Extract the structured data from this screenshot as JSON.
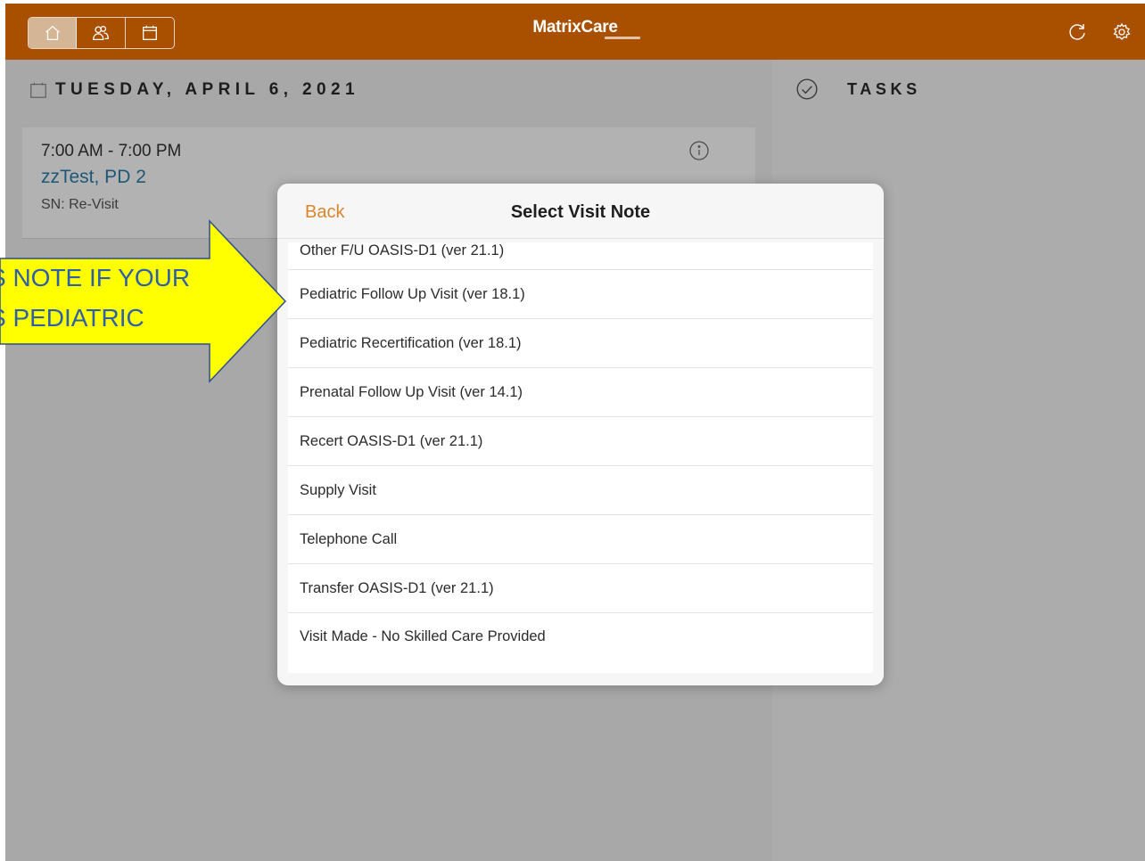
{
  "app": {
    "brand": "MatrixCare",
    "nav": [
      "home-icon",
      "patients-icon",
      "calendar-icon"
    ],
    "top_actions": [
      "refresh-icon",
      "gear-icon"
    ],
    "accent_color": "#a85000"
  },
  "schedule": {
    "date_heading": "TUESDAY, APRIL 6, 2021",
    "visit": {
      "time": "7:00 AM - 7:00 PM",
      "patient": "zzTest, PD 2",
      "type": "SN: Re-Visit"
    }
  },
  "tasks": {
    "heading": "TASKS"
  },
  "modal": {
    "back_label": "Back",
    "title": "Select Visit Note",
    "items": [
      "Other F/U OASIS-D1 (ver 21.1)",
      "Pediatric Follow Up Visit (ver 18.1)",
      "Pediatric Recertification (ver 18.1)",
      "Prenatal Follow Up Visit (ver 14.1)",
      "Recert OASIS-D1 (ver 21.1)",
      "Supply Visit",
      "Telephone Call",
      "Transfer OASIS-D1 (ver 21.1)",
      "Visit Made - No Skilled Care Provided"
    ]
  },
  "annotation": {
    "line1": "S NOTE IF YOUR",
    "line2": "S PEDIATRIC"
  }
}
